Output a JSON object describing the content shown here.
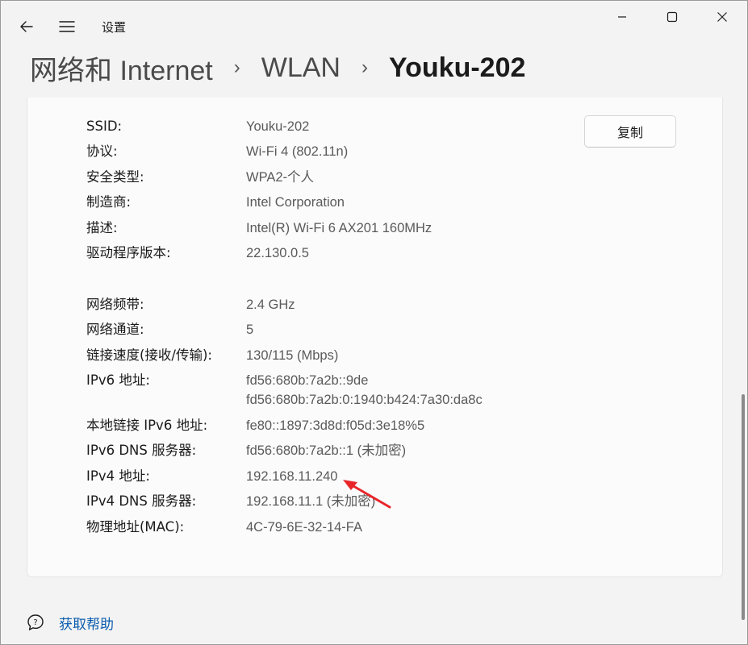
{
  "window": {
    "app_title": "设置",
    "colors": {
      "accent": "#0b5cad",
      "annotation": "#e8262a"
    }
  },
  "breadcrumb": {
    "items": [
      "网络和 Internet",
      "WLAN",
      "Youku-202"
    ]
  },
  "copy_button": {
    "label": "复制"
  },
  "properties": [
    {
      "label": "SSID:",
      "value": "Youku-202"
    },
    {
      "label": "协议:",
      "value": "Wi-Fi 4 (802.11n)"
    },
    {
      "label": "安全类型:",
      "value": "WPA2-个人"
    },
    {
      "label": "制造商:",
      "value": "Intel Corporation"
    },
    {
      "label": "描述:",
      "value": "Intel(R) Wi-Fi 6 AX201 160MHz"
    },
    {
      "label": "驱动程序版本:",
      "value": "22.130.0.5"
    },
    {
      "label": "网络频带:",
      "value": "2.4 GHz"
    },
    {
      "label": "网络通道:",
      "value": "5"
    },
    {
      "label": "链接速度(接收/传输):",
      "value": "130/115 (Mbps)"
    },
    {
      "label": "IPv6 地址:",
      "value": "fd56:680b:7a2b::9de",
      "value2": "fd56:680b:7a2b:0:1940:b424:7a30:da8c"
    },
    {
      "label": "本地链接 IPv6 地址:",
      "value": "fe80::1897:3d8d:f05d:3e18%5"
    },
    {
      "label": "IPv6 DNS 服务器:",
      "value": "fd56:680b:7a2b::1 (未加密)"
    },
    {
      "label": "IPv4 地址:",
      "value": "192.168.11.240"
    },
    {
      "label": "IPv4 DNS 服务器:",
      "value": "192.168.11.1 (未加密)"
    },
    {
      "label": "物理地址(MAC):",
      "value": "4C-79-6E-32-14-FA"
    }
  ],
  "help": {
    "label": "获取帮助",
    "icon": "help-chat-icon"
  }
}
